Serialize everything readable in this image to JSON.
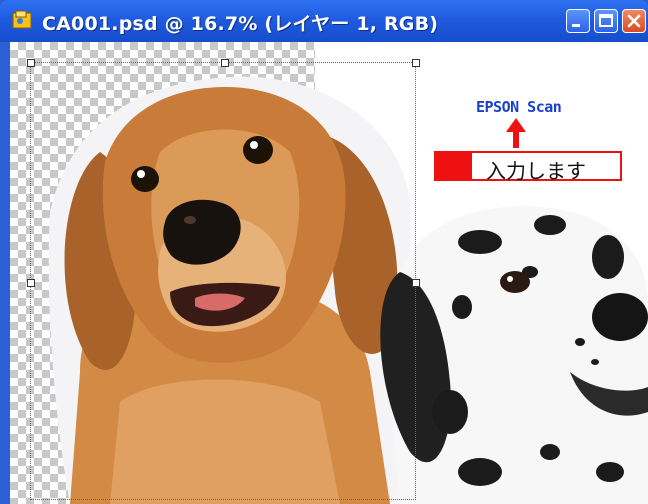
{
  "window": {
    "title": "CA001.psd @ 16.7% (レイヤー 1, RGB)",
    "buttons": [
      "minimize",
      "maximize",
      "close"
    ]
  },
  "annotation": {
    "brand_label": "EPSON Scan",
    "input_label": "入力します",
    "accent_color": "#ee1111",
    "brand_color": "#1a3fcc"
  },
  "icons": {
    "app": "photoshop-document-icon",
    "min": "minimize-icon",
    "max": "maximize-icon",
    "close": "close-icon"
  }
}
